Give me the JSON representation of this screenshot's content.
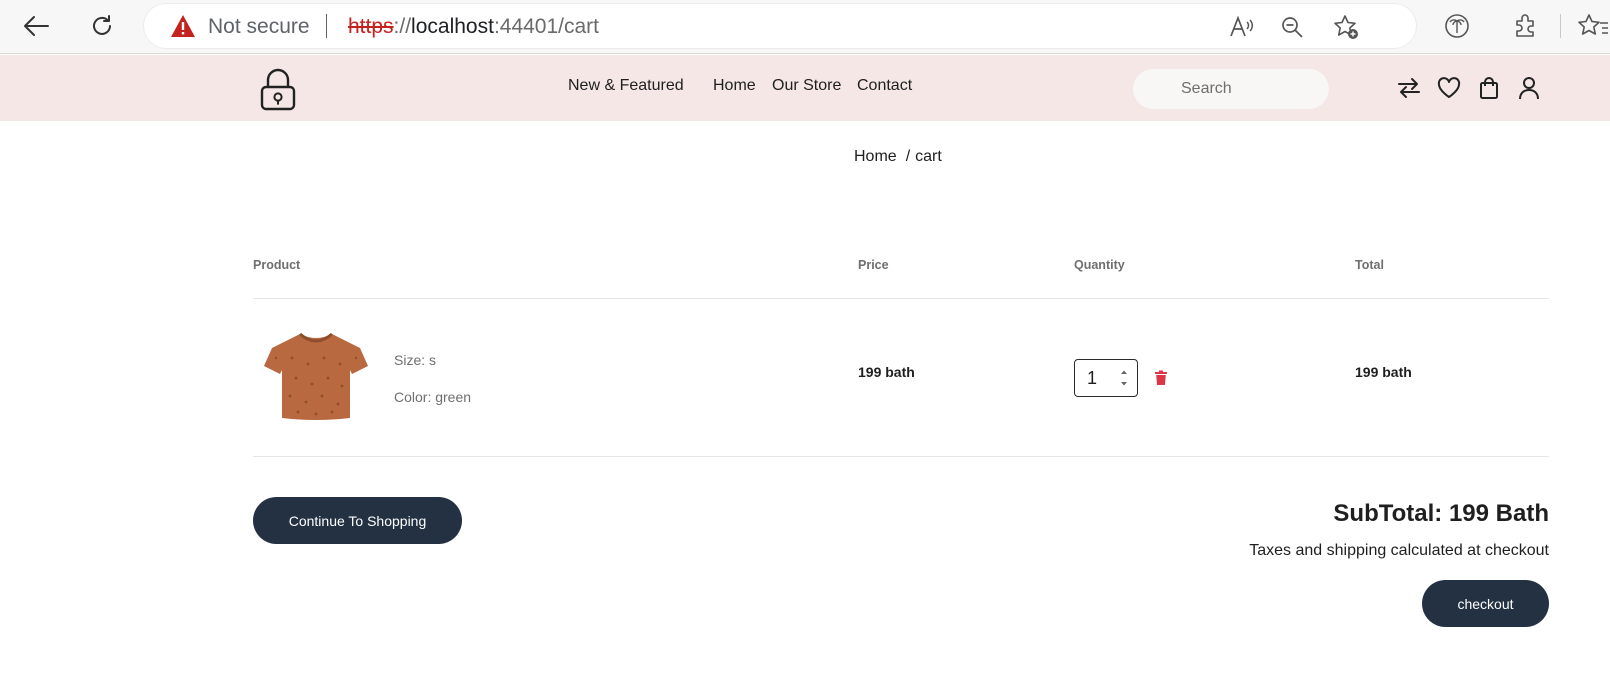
{
  "browser": {
    "security_label": "Not secure",
    "url": {
      "scheme": "https",
      "separator": "://",
      "host": "localhost",
      "port": ":44401",
      "path": "/cart"
    }
  },
  "header": {
    "nav": [
      "New & Featured",
      "Home",
      "Our Store",
      "Contact"
    ],
    "search_placeholder": "Search"
  },
  "breadcrumb": {
    "home": "Home",
    "separator": "/",
    "current": "cart"
  },
  "cart": {
    "columns": {
      "product": "Product",
      "price": "Price",
      "quantity": "Quantity",
      "total": "Total"
    },
    "items": [
      {
        "size": "Size: s",
        "color": "Color: green",
        "price": "199 bath",
        "quantity": "1",
        "total": "199 bath"
      }
    ],
    "continue_label": "Continue To Shopping",
    "subtotal": "SubTotal: 199 Bath",
    "tax_note": "Taxes and shipping calculated at checkout",
    "checkout_label": "checkout"
  },
  "colors": {
    "header_bg": "#f4e7e6",
    "button_bg": "#233142",
    "delete_red": "#dc3545",
    "shirt": "#b8693f"
  },
  "icons": {
    "browser": [
      "back-arrow-icon",
      "refresh-icon",
      "warning-icon",
      "read-aloud-icon",
      "zoom-out-icon",
      "add-favorite-icon",
      "palm-tree-icon",
      "extensions-icon",
      "favorites-icon"
    ],
    "header": [
      "lock-logo-icon",
      "compare-icon",
      "heart-icon",
      "shopping-bag-icon",
      "user-icon"
    ],
    "cart": [
      "trash-icon"
    ]
  }
}
